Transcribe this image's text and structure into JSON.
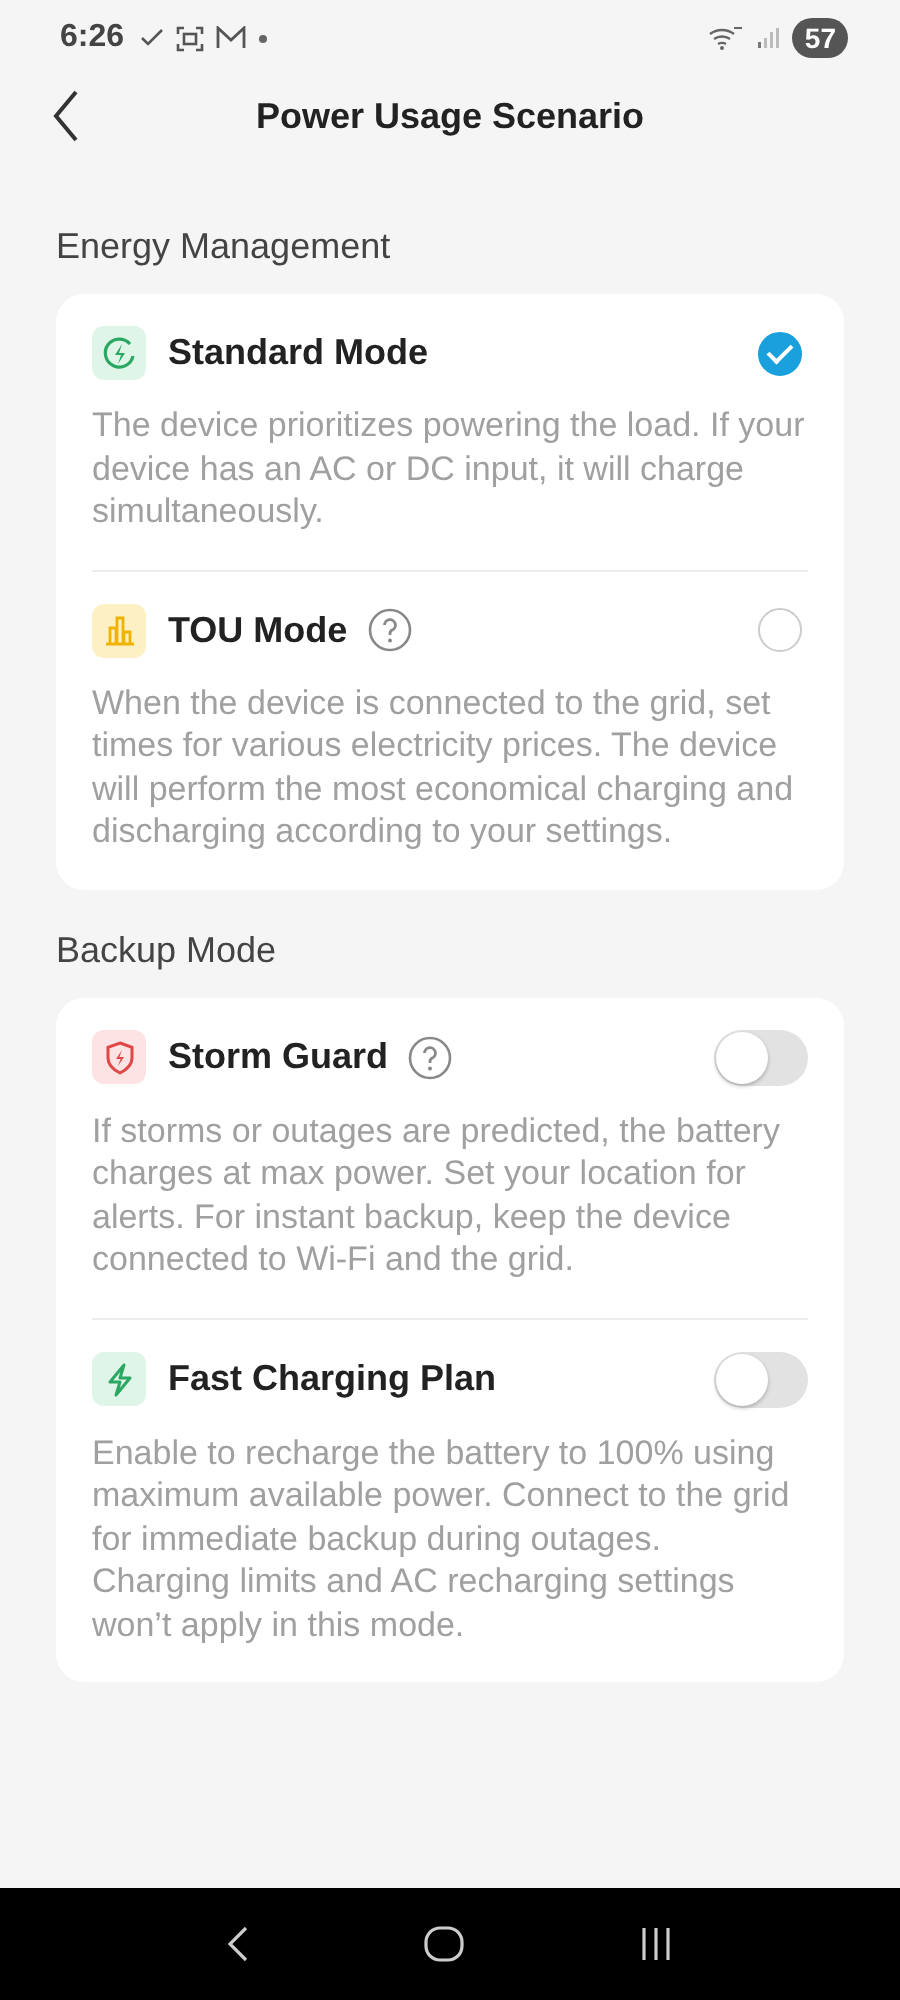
{
  "status_bar": {
    "time": "6:26",
    "battery": "57"
  },
  "header": {
    "title": "Power Usage Scenario"
  },
  "sections": [
    {
      "title": "Energy Management",
      "items": [
        {
          "kind": "radio",
          "title": "Standard Mode",
          "help": false,
          "selected": true,
          "description": "The device prioritizes powering the load. If your device has an AC or DC input, it will charge simultaneously."
        },
        {
          "kind": "radio",
          "title": "TOU Mode",
          "help": true,
          "selected": false,
          "description": "When the device is connected to the grid, set times for various electricity prices. The device will perform the most economical charging and discharging according to your settings."
        }
      ]
    },
    {
      "title": "Backup Mode",
      "items": [
        {
          "kind": "toggle",
          "title": "Storm Guard",
          "help": true,
          "on": false,
          "description": "If storms or outages are predicted, the battery charges at max power. Set your location for alerts. For instant backup, keep the device connected to Wi-Fi and the grid."
        },
        {
          "kind": "toggle",
          "title": "Fast Charging Plan",
          "help": false,
          "on": false,
          "description": "Enable to recharge the battery to 100% using maximum available power. Connect to the grid for immediate backup during outages. Charging limits and AC recharging settings won’t apply in this mode."
        }
      ]
    }
  ]
}
